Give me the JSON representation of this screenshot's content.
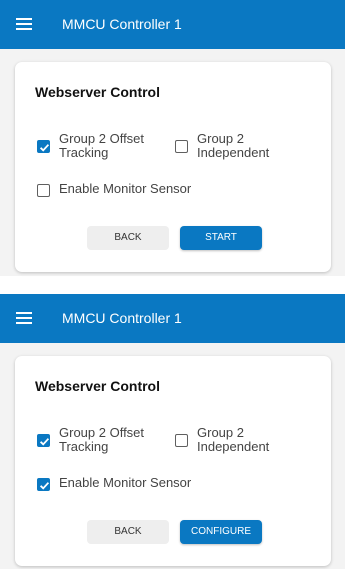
{
  "screens": [
    {
      "app_bar": {
        "title": "MMCU Controller 1",
        "menu_icon": "menu-icon"
      },
      "card": {
        "title": "Webserver Control",
        "options": {
          "offset_tracking": {
            "label": "Group 2 Offset Tracking",
            "checked": true
          },
          "independent": {
            "label": "Group 2 Independent",
            "checked": false
          },
          "monitor_sensor": {
            "label": "Enable Monitor Sensor",
            "checked": false
          }
        },
        "buttons": {
          "back": "BACK",
          "primary": "START"
        }
      }
    },
    {
      "app_bar": {
        "title": "MMCU Controller 1",
        "menu_icon": "menu-icon"
      },
      "card": {
        "title": "Webserver Control",
        "options": {
          "offset_tracking": {
            "label": "Group 2 Offset Tracking",
            "checked": true
          },
          "independent": {
            "label": "Group 2 Independent",
            "checked": false
          },
          "monitor_sensor": {
            "label": "Enable Monitor Sensor",
            "checked": true
          }
        },
        "buttons": {
          "back": "BACK",
          "primary": "CONFIGURE"
        }
      }
    }
  ],
  "colors": {
    "primary": "#0a78c2",
    "background": "#f3f3f3",
    "card": "#ffffff"
  }
}
